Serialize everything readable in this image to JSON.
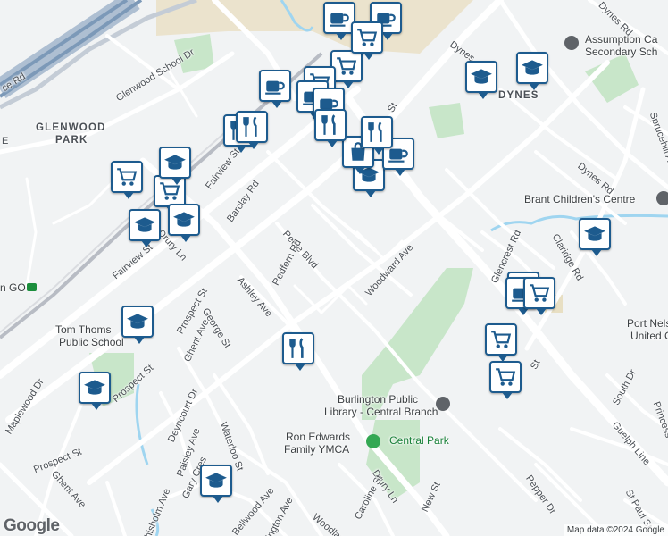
{
  "map": {
    "area_labels": [
      {
        "id": "glenwood-park-line1",
        "text": "GLENWOOD"
      },
      {
        "id": "glenwood-park-line2",
        "text": "PARK"
      },
      {
        "id": "dynes",
        "text": "DYNES"
      }
    ],
    "streets": [
      {
        "id": "ce-rd",
        "text": "ce Rd"
      },
      {
        "id": "glenwood-school-dr",
        "text": "Glenwood School Dr"
      },
      {
        "id": "fairview-st-north",
        "text": "Fairview St"
      },
      {
        "id": "fairview-st-south",
        "text": "Fairview St"
      },
      {
        "id": "barclay-rd",
        "text": "Barclay Rd"
      },
      {
        "id": "drury-ln-north",
        "text": "Drury Ln"
      },
      {
        "id": "drury-ln-south",
        "text": "Drury Ln"
      },
      {
        "id": "peele-blvd",
        "text": "Peele Blvd"
      },
      {
        "id": "redfern-rd",
        "text": "Redfern Rd"
      },
      {
        "id": "ashley-ave",
        "text": "Ashley Ave"
      },
      {
        "id": "woodward-ave",
        "text": "Woodward Ave"
      },
      {
        "id": "prospect-st-1",
        "text": "Prospect St"
      },
      {
        "id": "prospect-st-2",
        "text": "Prospect St"
      },
      {
        "id": "prospect-st-3",
        "text": "Prospect St"
      },
      {
        "id": "george-st",
        "text": "George St"
      },
      {
        "id": "ghent-ave-1",
        "text": "Ghent Ave"
      },
      {
        "id": "ghent-ave-2",
        "text": "Ghent Ave"
      },
      {
        "id": "maplewood-dr",
        "text": "Maplewood Dr"
      },
      {
        "id": "deyncourt-dr",
        "text": "Deyncourt Dr"
      },
      {
        "id": "paisley-ave",
        "text": "Paisley Ave"
      },
      {
        "id": "waterloo-st",
        "text": "Waterloo St"
      },
      {
        "id": "gary-cres",
        "text": "Gary Cres"
      },
      {
        "id": "chisholm-ave",
        "text": "hisholm Ave"
      },
      {
        "id": "bellwood-ave",
        "text": "Bellwood Ave"
      },
      {
        "id": "lington-ave",
        "text": "ington Ave"
      },
      {
        "id": "woodland",
        "text": "Woodlan"
      },
      {
        "id": "caroline-st",
        "text": "Caroline St"
      },
      {
        "id": "new-st",
        "text": "New St"
      },
      {
        "id": "guelph-line",
        "text": "Guelph Line"
      },
      {
        "id": "st-guelph",
        "text": "St"
      },
      {
        "id": "dynes-rd-top",
        "text": "Dynes Rd"
      },
      {
        "id": "dynes-rd",
        "text": "Dynes Rd"
      },
      {
        "id": "dynes-rd-2",
        "text": "Dynes"
      },
      {
        "id": "glencrest-rd",
        "text": "Glencrest Rd"
      },
      {
        "id": "claridge-rd",
        "text": "Claridge Rd"
      },
      {
        "id": "sprucehill-ave",
        "text": "Sprucehill Ave"
      },
      {
        "id": "south-dr",
        "text": "South Dr"
      },
      {
        "id": "princess",
        "text": "Princess"
      },
      {
        "id": "pepper-dr",
        "text": "Pepper Dr"
      },
      {
        "id": "st-paul-st",
        "text": "St Paul St"
      },
      {
        "id": "st-top",
        "text": "St"
      },
      {
        "id": "e-left",
        "text": "E"
      }
    ],
    "pois": [
      {
        "id": "assumption-line1",
        "text": "Assumption Ca"
      },
      {
        "id": "assumption-line2",
        "text": "Secondary Sch"
      },
      {
        "id": "brant-childrens-centre",
        "text": "Brant Children's Centre"
      },
      {
        "id": "port-nelson-line1",
        "text": "Port Nels"
      },
      {
        "id": "port-nelson-line2",
        "text": "United Chur"
      },
      {
        "id": "tom-thomson-line1",
        "text": "Tom Thoms"
      },
      {
        "id": "tom-thomson-line2",
        "text": "Public School"
      },
      {
        "id": "library-line1",
        "text": "Burlington Public"
      },
      {
        "id": "library-line2",
        "text": "Library - Central Branch"
      },
      {
        "id": "ymca-line1",
        "text": "Ron Edwards"
      },
      {
        "id": "ymca-line2",
        "text": "Family YMCA"
      },
      {
        "id": "central-park",
        "text": "Central Park"
      },
      {
        "id": "go-station",
        "text": "n GO"
      }
    ],
    "markers": [
      {
        "type": "cafe"
      },
      {
        "type": "cafe"
      },
      {
        "type": "grocery"
      },
      {
        "type": "school"
      },
      {
        "type": "cafe"
      },
      {
        "type": "grocery"
      },
      {
        "type": "school"
      },
      {
        "type": "school"
      },
      {
        "type": "cafe"
      },
      {
        "type": "cafe"
      },
      {
        "type": "restaurant"
      },
      {
        "type": "restaurant"
      },
      {
        "type": "grocery"
      },
      {
        "type": "grocery"
      },
      {
        "type": "school"
      },
      {
        "type": "school"
      },
      {
        "type": "school"
      },
      {
        "type": "shopping"
      },
      {
        "type": "cafe"
      },
      {
        "type": "school"
      },
      {
        "type": "restaurant"
      },
      {
        "type": "restaurant"
      },
      {
        "type": "school"
      },
      {
        "type": "school"
      },
      {
        "type": "grocery"
      },
      {
        "type": "grocery"
      },
      {
        "type": "school"
      },
      {
        "type": "school"
      },
      {
        "type": "cafe"
      },
      {
        "type": "grocery"
      },
      {
        "type": "restaurant"
      },
      {
        "type": "grocery"
      }
    ],
    "logo": "Google",
    "attribution": "Map data ©2024 Google",
    "colors": {
      "marker_border": "#1d5b8e",
      "park": "#c8e6c9",
      "water": "#9fd5f0",
      "rail": "#b8bcc4",
      "road": "#ffffff",
      "land": "#f1f3f4",
      "highway": "#7c99b8"
    }
  }
}
